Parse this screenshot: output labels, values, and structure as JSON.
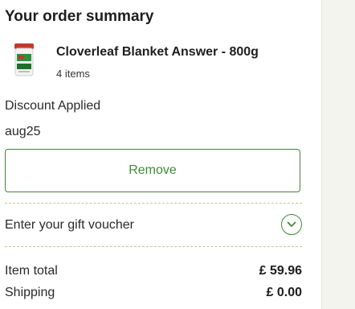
{
  "summary": {
    "title": "Your order summary"
  },
  "product": {
    "name": "Cloverleaf Blanket Answer - 800g",
    "quantity": "4 items",
    "thumbnail_icon": "product-tub-icon"
  },
  "discount": {
    "label": "Discount Applied",
    "code": "aug25",
    "remove_label": "Remove"
  },
  "voucher": {
    "label": "Enter your gift voucher",
    "toggle_icon": "chevron-down-icon"
  },
  "totals": {
    "item_total_label": "Item total",
    "item_total_value": "£ 59.96",
    "shipping_label": "Shipping",
    "shipping_value": "£ 0.00"
  },
  "colors": {
    "accent_green": "#3f8a37",
    "dashed_divider": "#c9c98a",
    "side_background": "#f4f4ef"
  }
}
